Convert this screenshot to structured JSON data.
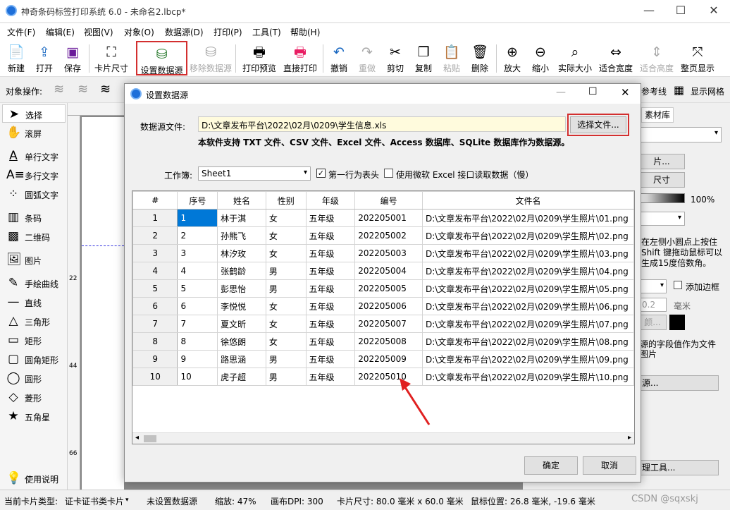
{
  "window": {
    "title": "神奇条码标签打印系统 6.0 - 未命名2.lbcp*",
    "min": "—",
    "max": "☐",
    "close": "✕"
  },
  "menu": [
    "文件(F)",
    "编辑(E)",
    "视图(V)",
    "对象(O)",
    "数据源(D)",
    "打印(P)",
    "工具(T)",
    "帮助(H)"
  ],
  "toolbar": {
    "new": "新建",
    "open": "打开",
    "save": "保存",
    "card_size": "卡片尺寸",
    "set_datasource": "设置数据源",
    "remove_datasource": "移除数据源",
    "print_preview": "打印预览",
    "direct_print": "直接打印",
    "undo": "撤销",
    "redo": "重做",
    "cut": "剪切",
    "copy": "复制",
    "paste": "粘贴",
    "delete": "删除",
    "zoom_in": "放大",
    "zoom_out": "缩小",
    "actual_size": "实际大小",
    "fit_width": "适合宽度",
    "fit_height": "适合高度",
    "fit_page": "整页显示"
  },
  "objbar": {
    "label": "对象操作:",
    "guide": "参考线",
    "grid": "显示网格"
  },
  "tools": [
    "选择",
    "滚屏",
    "单行文字",
    "多行文字",
    "圆弧文字",
    "条码",
    "二维码",
    "图片",
    "手绘曲线",
    "直线",
    "三角形",
    "矩形",
    "圆角矩形",
    "圆形",
    "菱形",
    "五角星",
    "使用说明"
  ],
  "ruler": {
    "v1": "22",
    "v2": "44",
    "v3": "66"
  },
  "right": {
    "tab": "素材库",
    "btn1": "片...",
    "btn2": "尺寸",
    "opacity": "100%",
    "hint": "在左侧小圆点上按住 Shift 键拖动鼠标可以生成15度倍数角。",
    "add_border": "添加边框",
    "border_value": "0.2",
    "border_unit": "毫米",
    "color_btn": "颜...",
    "desc": "源的字段值作为文件图片",
    "src_btn": "源...",
    "mgr_btn": "理工具..."
  },
  "status": {
    "card_type_label": "当前卡片类型:",
    "card_type": "证卡证书类卡片",
    "datasource": "未设置数据源",
    "zoom": "缩放: 47%",
    "dpi": "画布DPI: 300",
    "card_size": "卡片尺寸: 80.0 毫米 x 60.0 毫米",
    "mouse": "鼠标位置: 26.8 毫米, -19.6 毫米",
    "watermark": "CSDN @sqxskj"
  },
  "dialog": {
    "title": "设置数据源",
    "file_label": "数据源文件:",
    "file_path": "D:\\文章发布平台\\2022\\02月\\0209\\学生信息.xls",
    "choose_btn": "选择文件...",
    "support": "本软件支持 TXT 文件、CSV 文件、Excel 文件、Access 数据库、SQLite 数据库作为数据源。",
    "sheet_label": "工作簿:",
    "sheet_value": "Sheet1",
    "first_row_header": "第一行为表头",
    "use_ms_excel": "使用微软 Excel 接口读取数据（慢）",
    "ok": "确定",
    "cancel": "取消",
    "columns": [
      "#",
      "序号",
      "姓名",
      "性别",
      "年级",
      "编号",
      "文件名"
    ],
    "rows": [
      [
        "1",
        "1",
        "林于淇",
        "女",
        "五年级",
        "202205001",
        "D:\\文章发布平台\\2022\\02月\\0209\\学生照片\\01.png"
      ],
      [
        "2",
        "2",
        "孙熊飞",
        "女",
        "五年级",
        "202205002",
        "D:\\文章发布平台\\2022\\02月\\0209\\学生照片\\02.png"
      ],
      [
        "3",
        "3",
        "林汐玫",
        "女",
        "五年级",
        "202205003",
        "D:\\文章发布平台\\2022\\02月\\0209\\学生照片\\03.png"
      ],
      [
        "4",
        "4",
        "张鹤龄",
        "男",
        "五年级",
        "202205004",
        "D:\\文章发布平台\\2022\\02月\\0209\\学生照片\\04.png"
      ],
      [
        "5",
        "5",
        "彭思怡",
        "男",
        "五年级",
        "202205005",
        "D:\\文章发布平台\\2022\\02月\\0209\\学生照片\\05.png"
      ],
      [
        "6",
        "6",
        "李悦悦",
        "女",
        "五年级",
        "202205006",
        "D:\\文章发布平台\\2022\\02月\\0209\\学生照片\\06.png"
      ],
      [
        "7",
        "7",
        "夏文昕",
        "女",
        "五年级",
        "202205007",
        "D:\\文章发布平台\\2022\\02月\\0209\\学生照片\\07.png"
      ],
      [
        "8",
        "8",
        "徐悠朗",
        "女",
        "五年级",
        "202205008",
        "D:\\文章发布平台\\2022\\02月\\0209\\学生照片\\08.png"
      ],
      [
        "9",
        "9",
        "路思涵",
        "男",
        "五年级",
        "202205009",
        "D:\\文章发布平台\\2022\\02月\\0209\\学生照片\\09.png"
      ],
      [
        "10",
        "10",
        "虎子超",
        "男",
        "五年级",
        "202205010",
        "D:\\文章发布平台\\2022\\02月\\0209\\学生照片\\10.png"
      ]
    ]
  }
}
